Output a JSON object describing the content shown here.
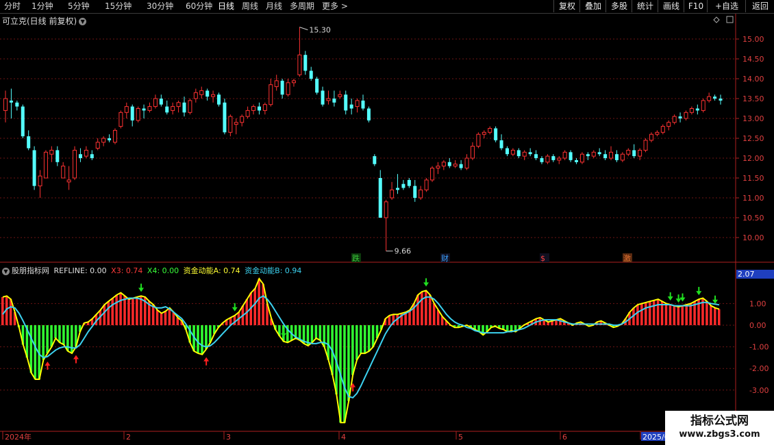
{
  "toolbar": {
    "periods": [
      "分时",
      "1分钟",
      "5分钟",
      "15分钟",
      "30分钟",
      "60分钟",
      "日线",
      "周线",
      "月线",
      "多周期",
      "更多 >"
    ],
    "active_period": "日线",
    "right_buttons": [
      "复权",
      "叠加",
      "多股",
      "统计",
      "画线",
      "F10",
      "+自选",
      "返回"
    ]
  },
  "stock": {
    "title": "可立克(日线 前复权)",
    "high_label": "15.30",
    "low_label": "9.66"
  },
  "price_axis": [
    "15.00",
    "14.50",
    "14.00",
    "13.50",
    "13.00",
    "12.50",
    "12.00",
    "11.50",
    "11.00",
    "10.50",
    "10.00"
  ],
  "event_markers": [
    "跌",
    "财",
    "$",
    "激"
  ],
  "indicator": {
    "name": "股朋指标网",
    "refline_label": "REFLINE: 0.00",
    "x3_label": "X3: 0.74",
    "x4_label": "X4: 0.00",
    "a_label": "资金动能A: 0.74",
    "b_label": "资金动能B: 0.94",
    "axis": [
      "1.00",
      "0.00",
      "-1.00",
      "-2.00",
      "-3.00"
    ],
    "current_value": "2.07"
  },
  "time_axis": [
    "2024年",
    "2",
    "3",
    "4",
    "5",
    "6",
    "2025/0"
  ],
  "watermark": {
    "title": "指标公式网",
    "url": "www.zbgs3.com"
  },
  "colors": {
    "up": "#ff3232",
    "down": "#54ffff",
    "line_b": "#3cd2f0",
    "line_a": "#ffff00",
    "hist_pos": "#ff2a2a",
    "hist_neg": "#32ff32"
  },
  "chart_data": {
    "type": "candlestick",
    "ylim": [
      9.5,
      15.5
    ],
    "candles": [
      [
        13.2,
        13.7,
        12.9,
        13.5
      ],
      [
        13.45,
        13.75,
        13.0,
        13.4
      ],
      [
        13.4,
        13.45,
        13.2,
        13.3
      ],
      [
        13.3,
        13.35,
        12.5,
        12.55
      ],
      [
        12.55,
        12.7,
        12.2,
        12.25
      ],
      [
        12.2,
        12.3,
        11.2,
        11.3
      ],
      [
        11.3,
        11.7,
        11.0,
        11.55
      ],
      [
        11.5,
        12.2,
        11.5,
        12.15
      ],
      [
        12.1,
        12.3,
        11.9,
        12.2
      ],
      [
        12.2,
        12.3,
        11.8,
        11.9
      ],
      [
        11.5,
        11.9,
        11.5,
        11.8
      ],
      [
        11.4,
        11.8,
        11.2,
        11.45
      ],
      [
        11.5,
        12.3,
        11.45,
        12.2
      ],
      [
        12.1,
        12.25,
        11.9,
        12.0
      ],
      [
        12.05,
        12.3,
        12.0,
        12.2
      ],
      [
        12.1,
        12.2,
        11.95,
        12.0
      ],
      [
        12.25,
        12.5,
        12.2,
        12.4
      ],
      [
        12.4,
        12.55,
        12.3,
        12.5
      ],
      [
        12.5,
        12.6,
        12.4,
        12.45
      ],
      [
        12.4,
        12.75,
        12.35,
        12.7
      ],
      [
        12.8,
        13.2,
        12.75,
        13.15
      ],
      [
        13.15,
        13.4,
        13.0,
        13.3
      ],
      [
        13.3,
        13.35,
        12.8,
        12.95
      ],
      [
        12.95,
        13.3,
        12.9,
        13.25
      ],
      [
        13.25,
        13.35,
        13.0,
        13.2
      ],
      [
        13.2,
        13.4,
        13.15,
        13.3
      ],
      [
        13.3,
        13.6,
        13.25,
        13.5
      ],
      [
        13.5,
        13.6,
        13.3,
        13.35
      ],
      [
        13.3,
        13.45,
        13.1,
        13.15
      ],
      [
        13.2,
        13.4,
        13.1,
        13.3
      ],
      [
        13.3,
        13.45,
        13.15,
        13.4
      ],
      [
        13.4,
        13.55,
        13.05,
        13.15
      ],
      [
        13.15,
        13.5,
        13.1,
        13.45
      ],
      [
        13.5,
        13.75,
        13.4,
        13.65
      ],
      [
        13.6,
        13.8,
        13.5,
        13.7
      ],
      [
        13.7,
        13.75,
        13.45,
        13.55
      ],
      [
        13.55,
        13.7,
        13.4,
        13.6
      ],
      [
        13.6,
        13.65,
        13.3,
        13.35
      ],
      [
        13.4,
        13.5,
        12.6,
        12.65
      ],
      [
        12.65,
        13.1,
        12.55,
        13.05
      ],
      [
        12.85,
        13.0,
        12.6,
        12.9
      ],
      [
        12.9,
        13.1,
        12.8,
        13.05
      ],
      [
        13.05,
        13.3,
        13.0,
        13.2
      ],
      [
        13.2,
        13.35,
        13.1,
        13.3
      ],
      [
        13.3,
        13.4,
        13.1,
        13.2
      ],
      [
        13.2,
        13.4,
        13.1,
        13.35
      ],
      [
        13.35,
        14.0,
        13.3,
        13.85
      ],
      [
        13.8,
        14.1,
        13.7,
        13.95
      ],
      [
        13.95,
        14.0,
        13.5,
        13.6
      ],
      [
        13.6,
        14.0,
        13.55,
        13.9
      ],
      [
        13.9,
        14.0,
        13.8,
        13.95
      ],
      [
        14.1,
        15.3,
        14.05,
        14.6
      ],
      [
        14.6,
        14.7,
        14.1,
        14.2
      ],
      [
        14.2,
        14.3,
        13.95,
        14.0
      ],
      [
        14.0,
        14.05,
        13.6,
        13.65
      ],
      [
        13.7,
        13.8,
        13.3,
        13.35
      ],
      [
        13.45,
        13.7,
        13.35,
        13.5
      ],
      [
        13.5,
        13.7,
        13.3,
        13.4
      ],
      [
        13.55,
        13.7,
        13.5,
        13.6
      ],
      [
        13.6,
        13.7,
        13.1,
        13.2
      ],
      [
        13.35,
        13.5,
        13.1,
        13.25
      ],
      [
        13.3,
        13.5,
        13.15,
        13.45
      ],
      [
        13.45,
        13.6,
        13.2,
        13.25
      ],
      [
        13.25,
        13.3,
        12.9,
        12.95
      ],
      [
        12.05,
        12.1,
        11.8,
        11.85
      ],
      [
        11.5,
        11.7,
        10.5,
        10.5
      ],
      [
        10.5,
        10.95,
        9.66,
        10.9
      ],
      [
        11.0,
        11.4,
        10.95,
        11.2
      ],
      [
        11.25,
        11.6,
        11.1,
        11.2
      ],
      [
        11.35,
        11.45,
        11.2,
        11.25
      ],
      [
        11.45,
        11.5,
        11.25,
        11.3
      ],
      [
        11.3,
        11.45,
        10.9,
        11.0
      ],
      [
        11.0,
        11.3,
        10.95,
        11.2
      ],
      [
        11.2,
        11.5,
        11.15,
        11.45
      ],
      [
        11.45,
        11.8,
        11.4,
        11.75
      ],
      [
        11.75,
        11.9,
        11.6,
        11.8
      ],
      [
        11.8,
        11.95,
        11.7,
        11.9
      ],
      [
        11.9,
        12.0,
        11.75,
        11.8
      ],
      [
        11.8,
        11.95,
        11.75,
        11.85
      ],
      [
        11.85,
        11.95,
        11.7,
        11.75
      ],
      [
        11.75,
        12.1,
        11.7,
        12.0
      ],
      [
        12.0,
        12.4,
        11.95,
        12.3
      ],
      [
        12.3,
        12.65,
        12.25,
        12.6
      ],
      [
        12.6,
        12.7,
        12.5,
        12.65
      ],
      [
        12.65,
        12.8,
        12.6,
        12.75
      ],
      [
        12.75,
        12.8,
        12.4,
        12.45
      ],
      [
        12.45,
        12.6,
        12.2,
        12.25
      ],
      [
        12.25,
        12.3,
        12.05,
        12.1
      ],
      [
        12.1,
        12.25,
        12.05,
        12.2
      ],
      [
        12.2,
        12.25,
        12.0,
        12.05
      ],
      [
        12.05,
        12.2,
        11.95,
        12.15
      ],
      [
        12.15,
        12.25,
        12.05,
        12.1
      ],
      [
        12.1,
        12.2,
        11.95,
        12.0
      ],
      [
        12.0,
        12.05,
        11.85,
        11.9
      ],
      [
        11.9,
        12.1,
        11.85,
        12.05
      ],
      [
        12.05,
        12.1,
        11.9,
        11.95
      ],
      [
        11.95,
        12.05,
        11.85,
        12.0
      ],
      [
        12.0,
        12.2,
        11.95,
        12.15
      ],
      [
        12.15,
        12.2,
        11.9,
        11.95
      ],
      [
        11.95,
        12.0,
        11.85,
        11.9
      ],
      [
        11.9,
        12.15,
        11.85,
        12.1
      ],
      [
        12.1,
        12.15,
        11.95,
        12.05
      ],
      [
        12.05,
        12.2,
        12.0,
        12.15
      ],
      [
        12.15,
        12.25,
        12.05,
        12.1
      ],
      [
        12.1,
        12.2,
        11.95,
        12.0
      ],
      [
        12.0,
        12.3,
        11.95,
        12.15
      ],
      [
        12.1,
        12.2,
        11.9,
        11.95
      ],
      [
        11.95,
        12.15,
        11.9,
        12.1
      ],
      [
        12.1,
        12.25,
        12.05,
        12.2
      ],
      [
        12.2,
        12.35,
        12.0,
        12.05
      ],
      [
        12.05,
        12.25,
        11.95,
        12.2
      ],
      [
        12.2,
        12.5,
        12.15,
        12.45
      ],
      [
        12.45,
        12.65,
        12.4,
        12.6
      ],
      [
        12.6,
        12.7,
        12.55,
        12.65
      ],
      [
        12.65,
        12.85,
        12.6,
        12.8
      ],
      [
        12.8,
        12.95,
        12.7,
        12.9
      ],
      [
        12.9,
        13.1,
        12.85,
        13.05
      ],
      [
        13.05,
        13.15,
        12.9,
        13.0
      ],
      [
        13.0,
        13.2,
        12.95,
        13.15
      ],
      [
        13.15,
        13.3,
        13.1,
        13.25
      ],
      [
        13.25,
        13.35,
        13.1,
        13.2
      ],
      [
        13.2,
        13.5,
        13.15,
        13.45
      ],
      [
        13.45,
        13.65,
        13.4,
        13.55
      ],
      [
        13.55,
        13.6,
        13.45,
        13.5
      ],
      [
        13.5,
        13.6,
        13.35,
        13.45
      ]
    ],
    "indicator_A": [
      1.3,
      1.35,
      1.2,
      0.6,
      -0.1,
      -0.9,
      -1.5,
      -2.2,
      -2.5,
      -2.5,
      -1.6,
      -1.3,
      -1.0,
      -0.6,
      -0.8,
      -0.9,
      -1.2,
      -1.3,
      -1.0,
      -0.3,
      0.1,
      0.15,
      0.3,
      0.5,
      0.7,
      0.95,
      1.1,
      1.25,
      1.4,
      1.5,
      1.35,
      1.2,
      1.25,
      1.3,
      1.35,
      1.3,
      1.1,
      0.95,
      0.7,
      0.55,
      0.65,
      0.8,
      0.6,
      0.35,
      0.2,
      -0.2,
      -0.8,
      -1.2,
      -1.3,
      -1.35,
      -1.1,
      -0.8,
      -0.4,
      -0.1,
      0.1,
      0.25,
      0.35,
      0.45,
      0.6,
      0.9,
      1.2,
      1.5,
      1.7,
      2.15,
      1.9,
      1.0,
      0.3,
      -0.2,
      -0.5,
      -0.75,
      -0.8,
      -0.7,
      -0.6,
      -0.7,
      -0.85,
      -0.95,
      -0.8,
      -0.6,
      -0.7,
      -1.0,
      -1.6,
      -2.3,
      -3.2,
      -4.5,
      -4.5,
      -3.5,
      -2.3,
      -1.6,
      -1.3,
      -1.3,
      -1.2,
      -1.0,
      -0.6,
      -0.2,
      0.3,
      0.45,
      0.5,
      0.5,
      0.55,
      0.6,
      0.7,
      1.0,
      1.4,
      1.55,
      1.6,
      1.4,
      1.0,
      0.7,
      0.4,
      0.2,
      0.0,
      -0.1,
      -0.1,
      -0.05,
      0.0,
      -0.1,
      -0.2,
      -0.3,
      -0.45,
      -0.3,
      -0.1,
      -0.05,
      -0.15,
      -0.2,
      -0.3,
      -0.25,
      -0.3,
      -0.15,
      0.0,
      0.1,
      0.2,
      0.3,
      0.35,
      0.25,
      0.15,
      0.2,
      0.25,
      0.3,
      0.2,
      0.1,
      0.0,
      0.1,
      0.15,
      0.05,
      -0.05,
      0.0,
      0.15,
      0.2,
      0.1,
      0.0,
      -0.1,
      -0.05,
      0.05,
      0.3,
      0.6,
      0.8,
      0.95,
      1.0,
      1.05,
      1.1,
      1.15,
      1.2,
      1.1,
      1.0,
      0.95,
      0.9,
      0.85,
      0.9,
      0.95,
      1.0,
      1.1,
      1.2,
      1.25,
      1.1,
      0.9,
      0.8,
      0.74
    ],
    "indicator_B": [
      0.5,
      0.75,
      0.85,
      0.8,
      0.55,
      0.2,
      -0.2,
      -0.6,
      -1.0,
      -1.35,
      -1.5,
      -1.45,
      -1.3,
      -1.15,
      -1.05,
      -1.0,
      -1.0,
      -1.05,
      -1.05,
      -0.9,
      -0.6,
      -0.3,
      -0.05,
      0.2,
      0.4,
      0.6,
      0.8,
      0.95,
      1.05,
      1.15,
      1.2,
      1.25,
      1.25,
      1.25,
      1.2,
      1.1,
      0.95,
      0.85,
      0.8,
      0.8,
      0.85,
      0.75,
      0.6,
      0.45,
      0.3,
      0.05,
      -0.25,
      -0.55,
      -0.8,
      -0.95,
      -1.0,
      -0.95,
      -0.8,
      -0.6,
      -0.4,
      -0.2,
      0.0,
      0.15,
      0.3,
      0.45,
      0.6,
      0.8,
      1.0,
      1.25,
      1.35,
      1.2,
      0.95,
      0.65,
      0.35,
      0.05,
      -0.2,
      -0.4,
      -0.55,
      -0.65,
      -0.75,
      -0.8,
      -0.85,
      -0.85,
      -0.8,
      -0.8,
      -0.9,
      -1.2,
      -1.7,
      -2.3,
      -2.9,
      -3.3,
      -3.35,
      -3.15,
      -2.8,
      -2.4,
      -2.0,
      -1.6,
      -1.2,
      -0.8,
      -0.4,
      -0.1,
      0.15,
      0.3,
      0.45,
      0.55,
      0.65,
      0.8,
      1.0,
      1.2,
      1.3,
      1.3,
      1.2,
      1.0,
      0.75,
      0.5,
      0.3,
      0.15,
      0.05,
      0.0,
      -0.1,
      -0.15,
      -0.25,
      -0.3,
      -0.35,
      -0.35,
      -0.35,
      -0.35,
      -0.35,
      -0.35,
      -0.3,
      -0.3,
      -0.25,
      -0.2,
      -0.15,
      -0.05,
      0.05,
      0.15,
      0.2,
      0.25,
      0.25,
      0.25,
      0.25,
      0.2,
      0.15,
      0.1,
      0.05,
      0.05,
      0.05,
      0.05,
      0.05,
      0.05,
      0.05,
      0.05,
      0.05,
      0.05,
      0.0,
      0.0,
      0.05,
      0.15,
      0.3,
      0.45,
      0.6,
      0.7,
      0.8,
      0.85,
      0.9,
      0.95,
      0.95,
      0.95,
      0.95,
      0.9,
      0.9,
      0.9,
      0.9,
      0.9,
      0.95,
      1.0,
      1.05,
      1.05,
      1.0,
      0.97,
      0.94
    ],
    "up_arrows": [
      11,
      18,
      50,
      86
    ],
    "down_arrows": [
      34,
      57,
      69,
      104,
      164,
      166,
      167,
      171,
      175
    ]
  }
}
